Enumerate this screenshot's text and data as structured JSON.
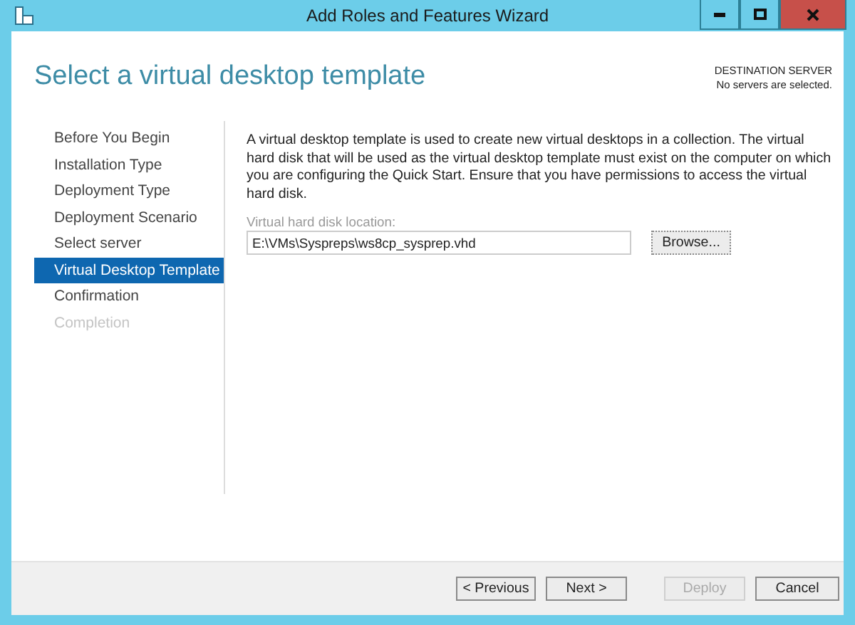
{
  "window": {
    "title": "Add Roles and Features Wizard"
  },
  "header": {
    "title": "Select a virtual desktop template",
    "destination_label": "DESTINATION SERVER",
    "destination_value": "No servers are selected."
  },
  "steps": [
    {
      "label": "Before You Begin",
      "selected": false,
      "disabled": false
    },
    {
      "label": "Installation Type",
      "selected": false,
      "disabled": false
    },
    {
      "label": "Deployment Type",
      "selected": false,
      "disabled": false
    },
    {
      "label": "Deployment Scenario",
      "selected": false,
      "disabled": false
    },
    {
      "label": "Select server",
      "selected": false,
      "disabled": false
    },
    {
      "label": "Virtual Desktop Template",
      "selected": true,
      "disabled": false
    },
    {
      "label": "Confirmation",
      "selected": false,
      "disabled": false
    },
    {
      "label": "Completion",
      "selected": false,
      "disabled": true
    }
  ],
  "description": "A virtual desktop template is used to create new virtual desktops in a collection. The virtual hard disk that will be used as the virtual desktop template must exist on the computer on which you are configuring the Quick Start. Ensure that you have permissions to access the virtual hard disk.",
  "vhd_field": {
    "label": "Virtual hard disk location:",
    "value": "E:\\VMs\\Syspreps\\ws8cp_sysprep.vhd"
  },
  "browse_button": "Browse...",
  "buttons": [
    {
      "label": "< Previous",
      "disabled": false
    },
    {
      "label": "Next >",
      "disabled": false
    },
    {
      "label": "Deploy",
      "disabled": true
    },
    {
      "label": "Cancel",
      "disabled": false
    }
  ]
}
